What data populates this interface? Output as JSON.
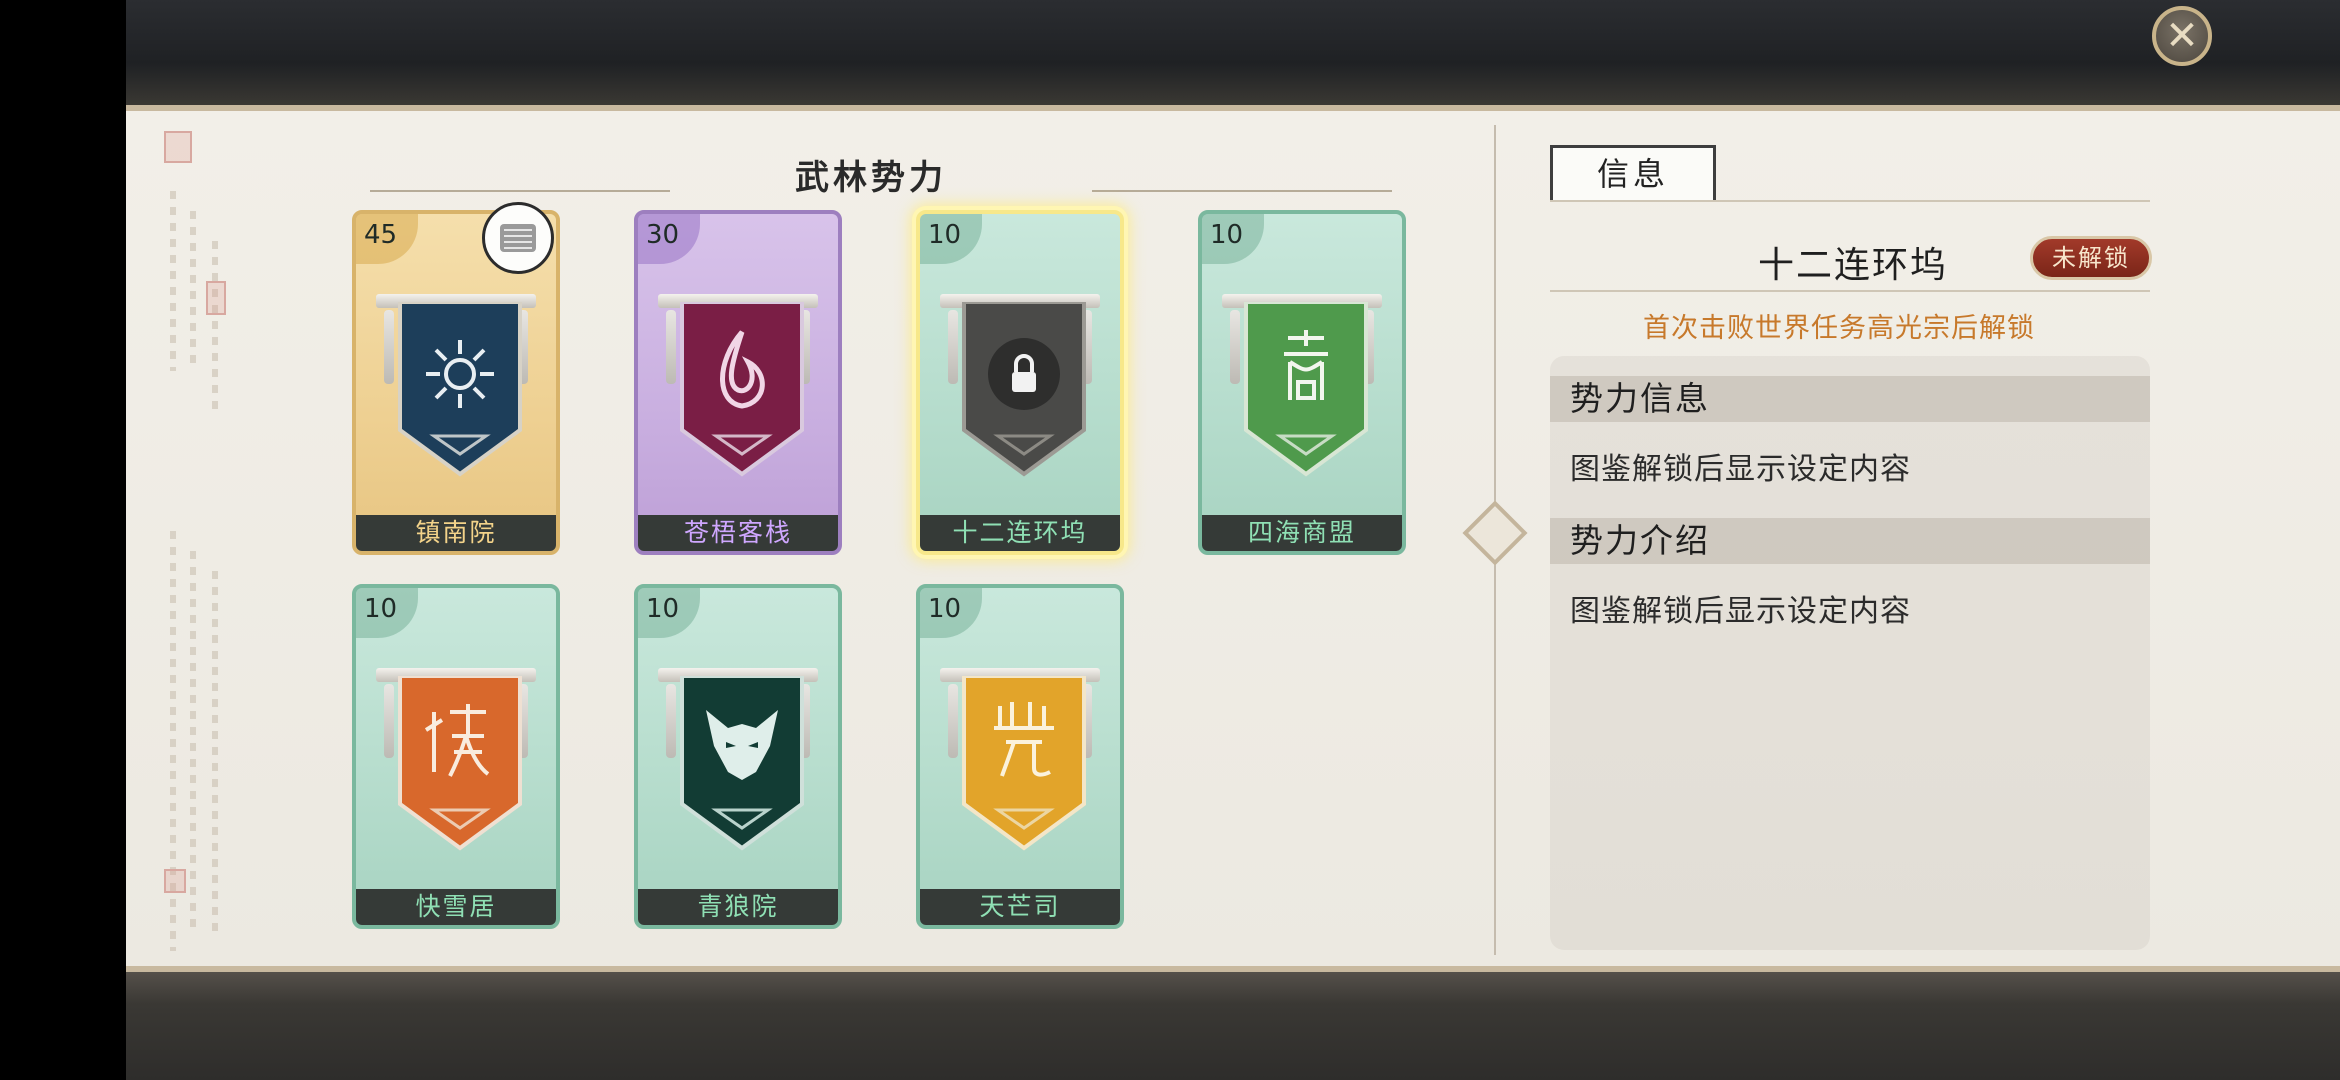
{
  "section_title": "武林势力",
  "factions": [
    {
      "name": "镇南院",
      "level": "45",
      "theme": "gold",
      "banner_color": "#1d3e5a",
      "emblem": "sun-emblem-icon"
    },
    {
      "name": "苍梧客栈",
      "level": "30",
      "theme": "purple",
      "banner_color": "#7a1e45",
      "emblem": "phoenix-emblem-icon"
    },
    {
      "name": "十二连环坞",
      "level": "10",
      "theme": "green",
      "banner_color": "#4a4a48",
      "emblem": "lock-icon",
      "selected": true
    },
    {
      "name": "四海商盟",
      "level": "10",
      "theme": "green",
      "banner_color": "#4f9a4c",
      "emblem": "seal-script-emblem-icon"
    },
    {
      "name": "快雪居",
      "level": "10",
      "theme": "green",
      "banner_color": "#d8682c",
      "emblem": "seal-script-emblem-icon"
    },
    {
      "name": "青狼院",
      "level": "10",
      "theme": "green",
      "banner_color": "#123c34",
      "emblem": "wolf-emblem-icon"
    },
    {
      "name": "天芒司",
      "level": "10",
      "theme": "green",
      "banner_color": "#e2a42a",
      "emblem": "seal-script-emblem-icon"
    }
  ],
  "detail": {
    "tab_label": "信息",
    "faction_name": "十二连环坞",
    "status_badge": "未解锁",
    "unlock_hint": "首次击败世界任务高光宗后解锁",
    "sections": [
      {
        "header": "势力信息",
        "text": "图鉴解锁后显示设定内容"
      },
      {
        "header": "势力介绍",
        "text": "图鉴解锁后显示设定内容"
      }
    ]
  },
  "colors": {
    "accent_gold": "#c7792b",
    "locked_red": "#8a2a1c",
    "selected_glow": "#f7e88a"
  }
}
